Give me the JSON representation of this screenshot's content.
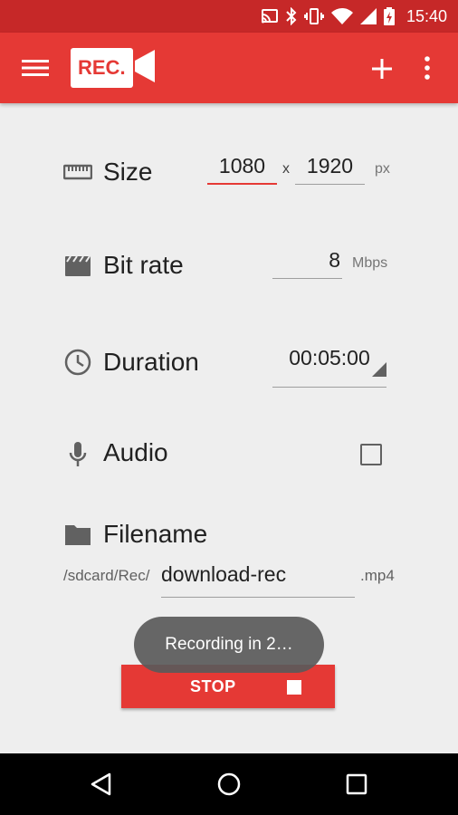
{
  "status_bar": {
    "time": "15:40",
    "icons": [
      "cast-icon",
      "bluetooth-icon",
      "vibrate-icon",
      "wifi-icon",
      "signal-icon",
      "battery-charging-icon"
    ]
  },
  "app_bar": {
    "logo_text": "REC.",
    "icons": [
      "menu-icon",
      "add-icon",
      "more-vert-icon"
    ]
  },
  "settings": {
    "size": {
      "label": "Size",
      "width": "1080",
      "separator": "x",
      "height": "1920",
      "unit": "px"
    },
    "bitrate": {
      "label": "Bit rate",
      "value": "8",
      "unit": "Mbps"
    },
    "duration": {
      "label": "Duration",
      "value": "00:05:00"
    },
    "audio": {
      "label": "Audio",
      "checked": false
    },
    "filename": {
      "label": "Filename",
      "prefix": "/sdcard/Rec/",
      "value": "download-rec",
      "extension": ".mp4"
    }
  },
  "stop_button": {
    "label": "STOP"
  },
  "toast": {
    "text": "Recording in 2…"
  },
  "colors": {
    "primary": "#e53935",
    "primary_dark": "#c62828",
    "background": "#eeeeee"
  }
}
